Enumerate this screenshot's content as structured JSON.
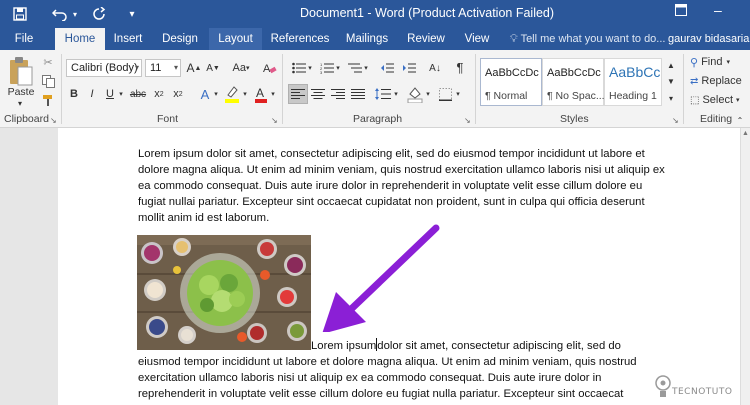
{
  "window": {
    "title": "Document1 - Word (Product Activation Failed)",
    "user_name": "gaurav bidasaria"
  },
  "tabs": [
    "File",
    "Home",
    "Insert",
    "Design",
    "Layout",
    "References",
    "Mailings",
    "Review",
    "View"
  ],
  "active_tab": "Home",
  "tell_me": "Tell me what you want to do...",
  "clipboard": {
    "paste_label": "Paste",
    "group_label": "Clipboard"
  },
  "font": {
    "name": "Calibri (Body)",
    "size": "11",
    "group_label": "Font",
    "grow": "A",
    "shrink": "A",
    "case": "Aa"
  },
  "paragraph": {
    "group_label": "Paragraph"
  },
  "styles": {
    "group_label": "Styles",
    "items": [
      {
        "sample": "AaBbCcDc",
        "name": "¶ Normal"
      },
      {
        "sample": "AaBbCcDc",
        "name": "¶ No Spac..."
      },
      {
        "sample": "AaBbCc",
        "name": "Heading 1"
      }
    ]
  },
  "editing": {
    "group_label": "Editing",
    "find": "Find",
    "replace": "Replace",
    "select": "Select"
  },
  "document": {
    "paragraph1": "Lorem ipsum dolor sit amet, consectetur adipiscing elit, sed do eiusmod tempor incididunt ut labore et dolore magna aliqua. Ut enim ad minim veniam, quis nostrud exercitation ullamco laboris nisi ut aliquip ex ea commodo consequat. Duis aute irure dolor in reprehenderit in voluptate velit esse cillum dolore eu fugiat nullai pariatur. Excepteur sint occaecat cupidatat non proident, sunt in culpa qui officia deserunt mollit anim id est laborum.",
    "paragraph2_before_cursor": "Lorem ipsum",
    "paragraph2_after_cursor": "dolor sit amet, consectetur adipiscing elit, sed do eiusmod tempor incididunt ut labore et dolore magna aliqua. Ut enim ad minim veniam, quis nostrud exercitation ullamco laboris nisi ut aliquip ex ea commodo consequat. Duis aute irure dolor in reprehenderit in voluptate velit esse cillum dolore eu fugiat nulla pariatur. Excepteur sint occaecat"
  },
  "watermark": "TECNOTUTO",
  "colors": {
    "word_blue": "#2b579a",
    "annotation_arrow": "#8b1fd6",
    "highlight_yellow": "#ffff00",
    "font_color_red": "#e02020"
  }
}
